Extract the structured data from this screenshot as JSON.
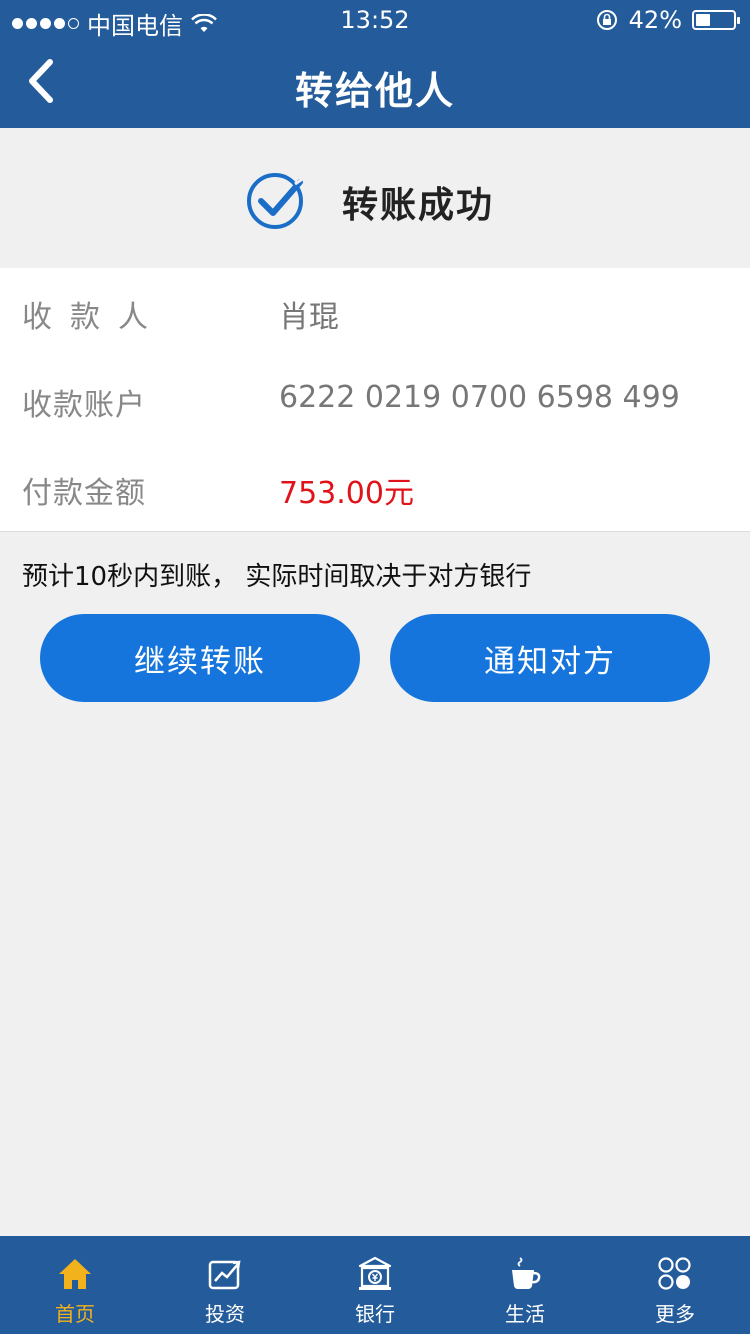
{
  "status_bar": {
    "carrier": "中国电信",
    "time": "13:52",
    "battery": "42%"
  },
  "header": {
    "title": "转给他人"
  },
  "result": {
    "status_text": "转账成功"
  },
  "details": {
    "payee_label": "收款人",
    "payee_value": "肖琨",
    "account_label": "收款账户",
    "account_value": "6222 0219 0700 6598 499",
    "amount_label": "付款金额",
    "amount_value": "753.00元"
  },
  "notice": "预计10秒内到账， 实际时间取决于对方银行",
  "buttons": {
    "continue_label": "继续转账",
    "notify_label": "通知对方"
  },
  "tabs": [
    {
      "label": "首页",
      "icon": "home-icon",
      "active": true
    },
    {
      "label": "投资",
      "icon": "chart-icon",
      "active": false
    },
    {
      "label": "银行",
      "icon": "bank-icon",
      "active": false
    },
    {
      "label": "生活",
      "icon": "coffee-icon",
      "active": false
    },
    {
      "label": "更多",
      "icon": "more-icon",
      "active": false
    }
  ],
  "colors": {
    "brand_blue": "#245c9b",
    "button_blue": "#1675dc",
    "amount_red": "#e0131b",
    "active_tab": "#f2b21c"
  }
}
